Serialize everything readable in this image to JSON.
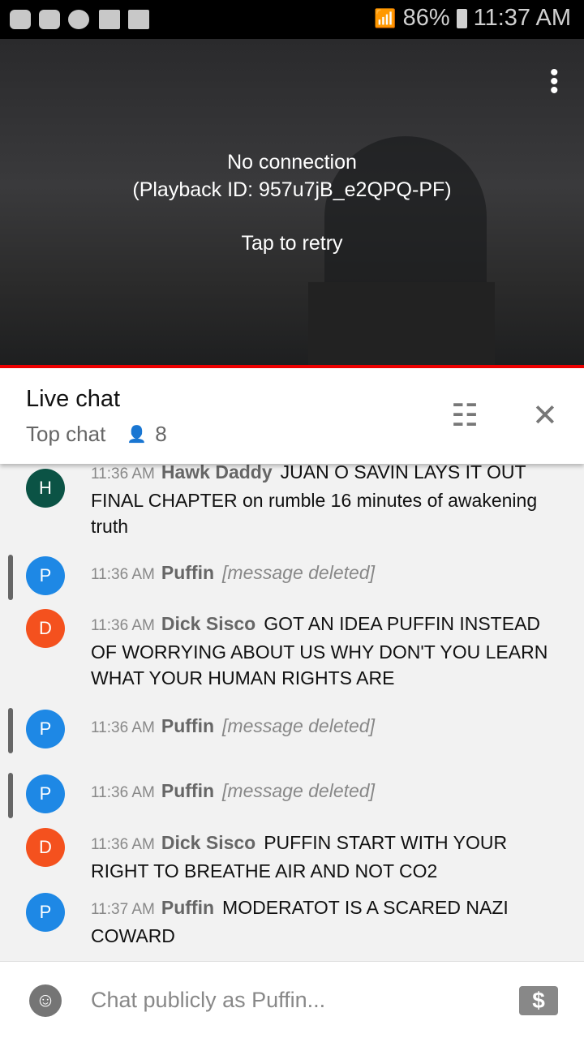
{
  "status_bar": {
    "battery": "86%",
    "time": "11:37 AM",
    "icons": [
      "youtube-icon",
      "youtube-icon",
      "m-app-icon",
      "folder-icon",
      "image-icon",
      "wifi-icon",
      "signal-icon",
      "battery-icon"
    ]
  },
  "player": {
    "error": "No connection",
    "playback_id": "(Playback ID: 957u7jB_e2QPQ-PF)",
    "retry": "Tap to retry",
    "menu_icon": "more-vert-icon"
  },
  "header": {
    "title": "Live chat",
    "mode": "Top chat",
    "viewers": "8"
  },
  "messages": [
    {
      "initial": "H",
      "color": "#0b5345",
      "time": "11:36 AM",
      "author": "Hawk Daddy",
      "text": "JUAN O SAVIN LAYS IT OUT FINAL CHAPTER on rumble 16 minutes of awakening truth"
    },
    {
      "initial": "P",
      "color": "#1e88e5",
      "time": "11:36 AM",
      "author": "Puffin",
      "deleted": "[message deleted]"
    },
    {
      "initial": "D",
      "color": "#f4511e",
      "time": "11:36 AM",
      "author": "Dick Sisco",
      "text": "GOT AN IDEA PUFFIN INSTEAD OF WORRYING ABOUT US WHY DON'T YOU LEARN WHAT YOUR HUMAN RIGHTS ARE"
    },
    {
      "initial": "P",
      "color": "#1e88e5",
      "time": "11:36 AM",
      "author": "Puffin",
      "deleted": "[message deleted]"
    },
    {
      "initial": "P",
      "color": "#1e88e5",
      "time": "11:36 AM",
      "author": "Puffin",
      "deleted": "[message deleted]"
    },
    {
      "initial": "D",
      "color": "#f4511e",
      "time": "11:36 AM",
      "author": "Dick Sisco",
      "text": "PUFFIN START WITH YOUR RIGHT TO BREATHE AIR AND NOT CO2"
    },
    {
      "initial": "P",
      "color": "#1e88e5",
      "time": "11:37 AM",
      "author": "Puffin",
      "text": "MODERATOT IS A SCARED NAZI COWARD"
    }
  ],
  "input": {
    "placeholder": "Chat publicly as Puffin..."
  }
}
